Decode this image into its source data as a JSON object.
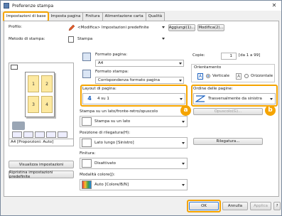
{
  "window": {
    "title": "Preferenze stampa",
    "close": "✕"
  },
  "tabs": [
    "Impostazioni di base",
    "Imposta pagina",
    "Finitura",
    "Alimentazione carta",
    "Qualità"
  ],
  "profile": {
    "label": "Profilo:",
    "value": "<Modifica> Impostazioni predefinite",
    "add": "Aggiungi(1)...",
    "edit": "Modifica(2)..."
  },
  "method": {
    "label": "Metodo di stampa:",
    "value": "Stampa"
  },
  "preview": {
    "pages": [
      "1",
      "2",
      "3",
      "4"
    ],
    "status": "A4 [Proporzioni: Auto]"
  },
  "left_buttons": {
    "view": "Visualizza impostazioni",
    "restore": "Ripristina impostazioni predefinite"
  },
  "page_size": {
    "label": "Formato pagina:",
    "value": "A4"
  },
  "output_size": {
    "label": "Formato stampa:",
    "value": "Corrispondenza formato pagina"
  },
  "copies": {
    "label": "Copie:",
    "value": "1",
    "range": "[da 1 a 99]"
  },
  "orientation": {
    "label": "Orientamento",
    "portrait_icon": "A",
    "portrait": "Verticale",
    "landscape_icon": "A",
    "landscape": "Orizzontale"
  },
  "layout": {
    "label": "Layout di pagina:",
    "icon": "4",
    "value": "4 su 1"
  },
  "page_order": {
    "label": "Ordine delle pagine:",
    "value": "Trasversalmente da sinistra"
  },
  "duplex": {
    "label": "Stampa su un lato/fronte-retro/opuscolo",
    "value": "Stampa su un lato",
    "booklet": "Opuscolo(G)..."
  },
  "binding": {
    "label": "Posizione di rilegatura(H):",
    "value": "Lato lungo [Sinistro]",
    "btn": "Rilegatura..."
  },
  "finishing": {
    "label": "Finitura:",
    "value": "Disattivato"
  },
  "color": {
    "label": "Modalità colore(J):",
    "value": "Auto [Colore/B/N]"
  },
  "badges": {
    "a": "a",
    "b": "b"
  },
  "footer": {
    "ok": "OK",
    "cancel": "Annulla",
    "apply": "Applica",
    "help": "?"
  },
  "colors": {
    "highlight": "#f5a400",
    "accent": "#1a60c0"
  }
}
